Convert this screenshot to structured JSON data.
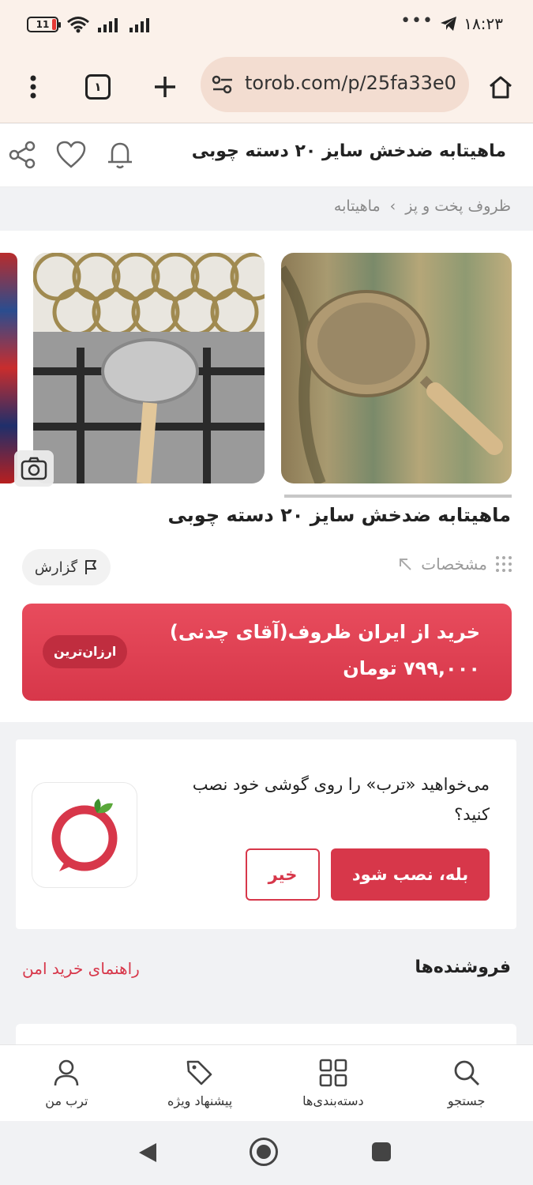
{
  "status_bar": {
    "time": "۱۸:۲۳",
    "battery": "11",
    "dots": "•••"
  },
  "browser": {
    "url": "torob.com/p/25fa33e0",
    "tab_count": "۱"
  },
  "header": {
    "title": "ماهیتابه ضدخش سایز ۲۰ دسته چوبی"
  },
  "breadcrumb": {
    "items": [
      "ظروف پخت و پز",
      "ماهیتابه"
    ],
    "separator": "›"
  },
  "product": {
    "title": "ماهیتابه ضدخش سایز ۲۰ دسته چوبی",
    "specs_label": "مشخصات",
    "report_label": "گزارش"
  },
  "offer": {
    "store": "خرید از ایران ظروف(آقای چدنی)",
    "price": "۷۹۹,۰۰۰ تومان",
    "badge": "ارزان‌ترین"
  },
  "install_prompt": {
    "question": "می‌خواهید «ترب» را روی گوشی خود نصب کنید؟",
    "yes_label": "بله، نصب شود",
    "no_label": "خیر"
  },
  "sellers": {
    "title": "فروشنده‌ها",
    "guide_link": "راهنمای خرید امن"
  },
  "bottom_nav": [
    {
      "label": "جستجو",
      "icon": "search-icon"
    },
    {
      "label": "دسته‌بندی‌ها",
      "icon": "grid-icon"
    },
    {
      "label": "پیشنهاد ویژه",
      "icon": "tag-icon"
    },
    {
      "label": "ترب من",
      "icon": "user-icon"
    }
  ],
  "colors": {
    "accent": "#d7374a",
    "browser_bg": "#fbf1ea",
    "url_pill": "#f3ddd1"
  }
}
